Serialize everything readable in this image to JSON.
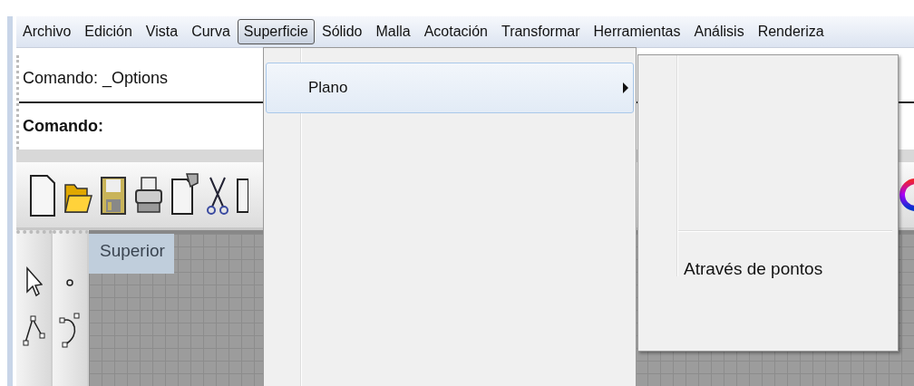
{
  "menubar": [
    {
      "label": "Archivo",
      "selected": false
    },
    {
      "label": "Edición",
      "selected": false
    },
    {
      "label": "Vista",
      "selected": false
    },
    {
      "label": "Curva",
      "selected": false
    },
    {
      "label": "Superficie",
      "selected": true
    },
    {
      "label": "Sólido",
      "selected": false
    },
    {
      "label": "Malla",
      "selected": false
    },
    {
      "label": "Acotación",
      "selected": false
    },
    {
      "label": "Transformar",
      "selected": false
    },
    {
      "label": "Herramientas",
      "selected": false
    },
    {
      "label": "Análisis",
      "selected": false
    },
    {
      "label": "Renderiza",
      "selected": false
    }
  ],
  "command_area": {
    "history": "Comando: _Options",
    "prompt": "Comando:"
  },
  "viewport": {
    "title": "Superior"
  },
  "dropdown": {
    "items": [
      {
        "label": "Plano",
        "selected": true,
        "has_submenu": true
      }
    ]
  },
  "submenu": {
    "items": [
      {
        "kind": "separator"
      },
      {
        "kind": "item",
        "label": "Através de pontos"
      }
    ]
  }
}
